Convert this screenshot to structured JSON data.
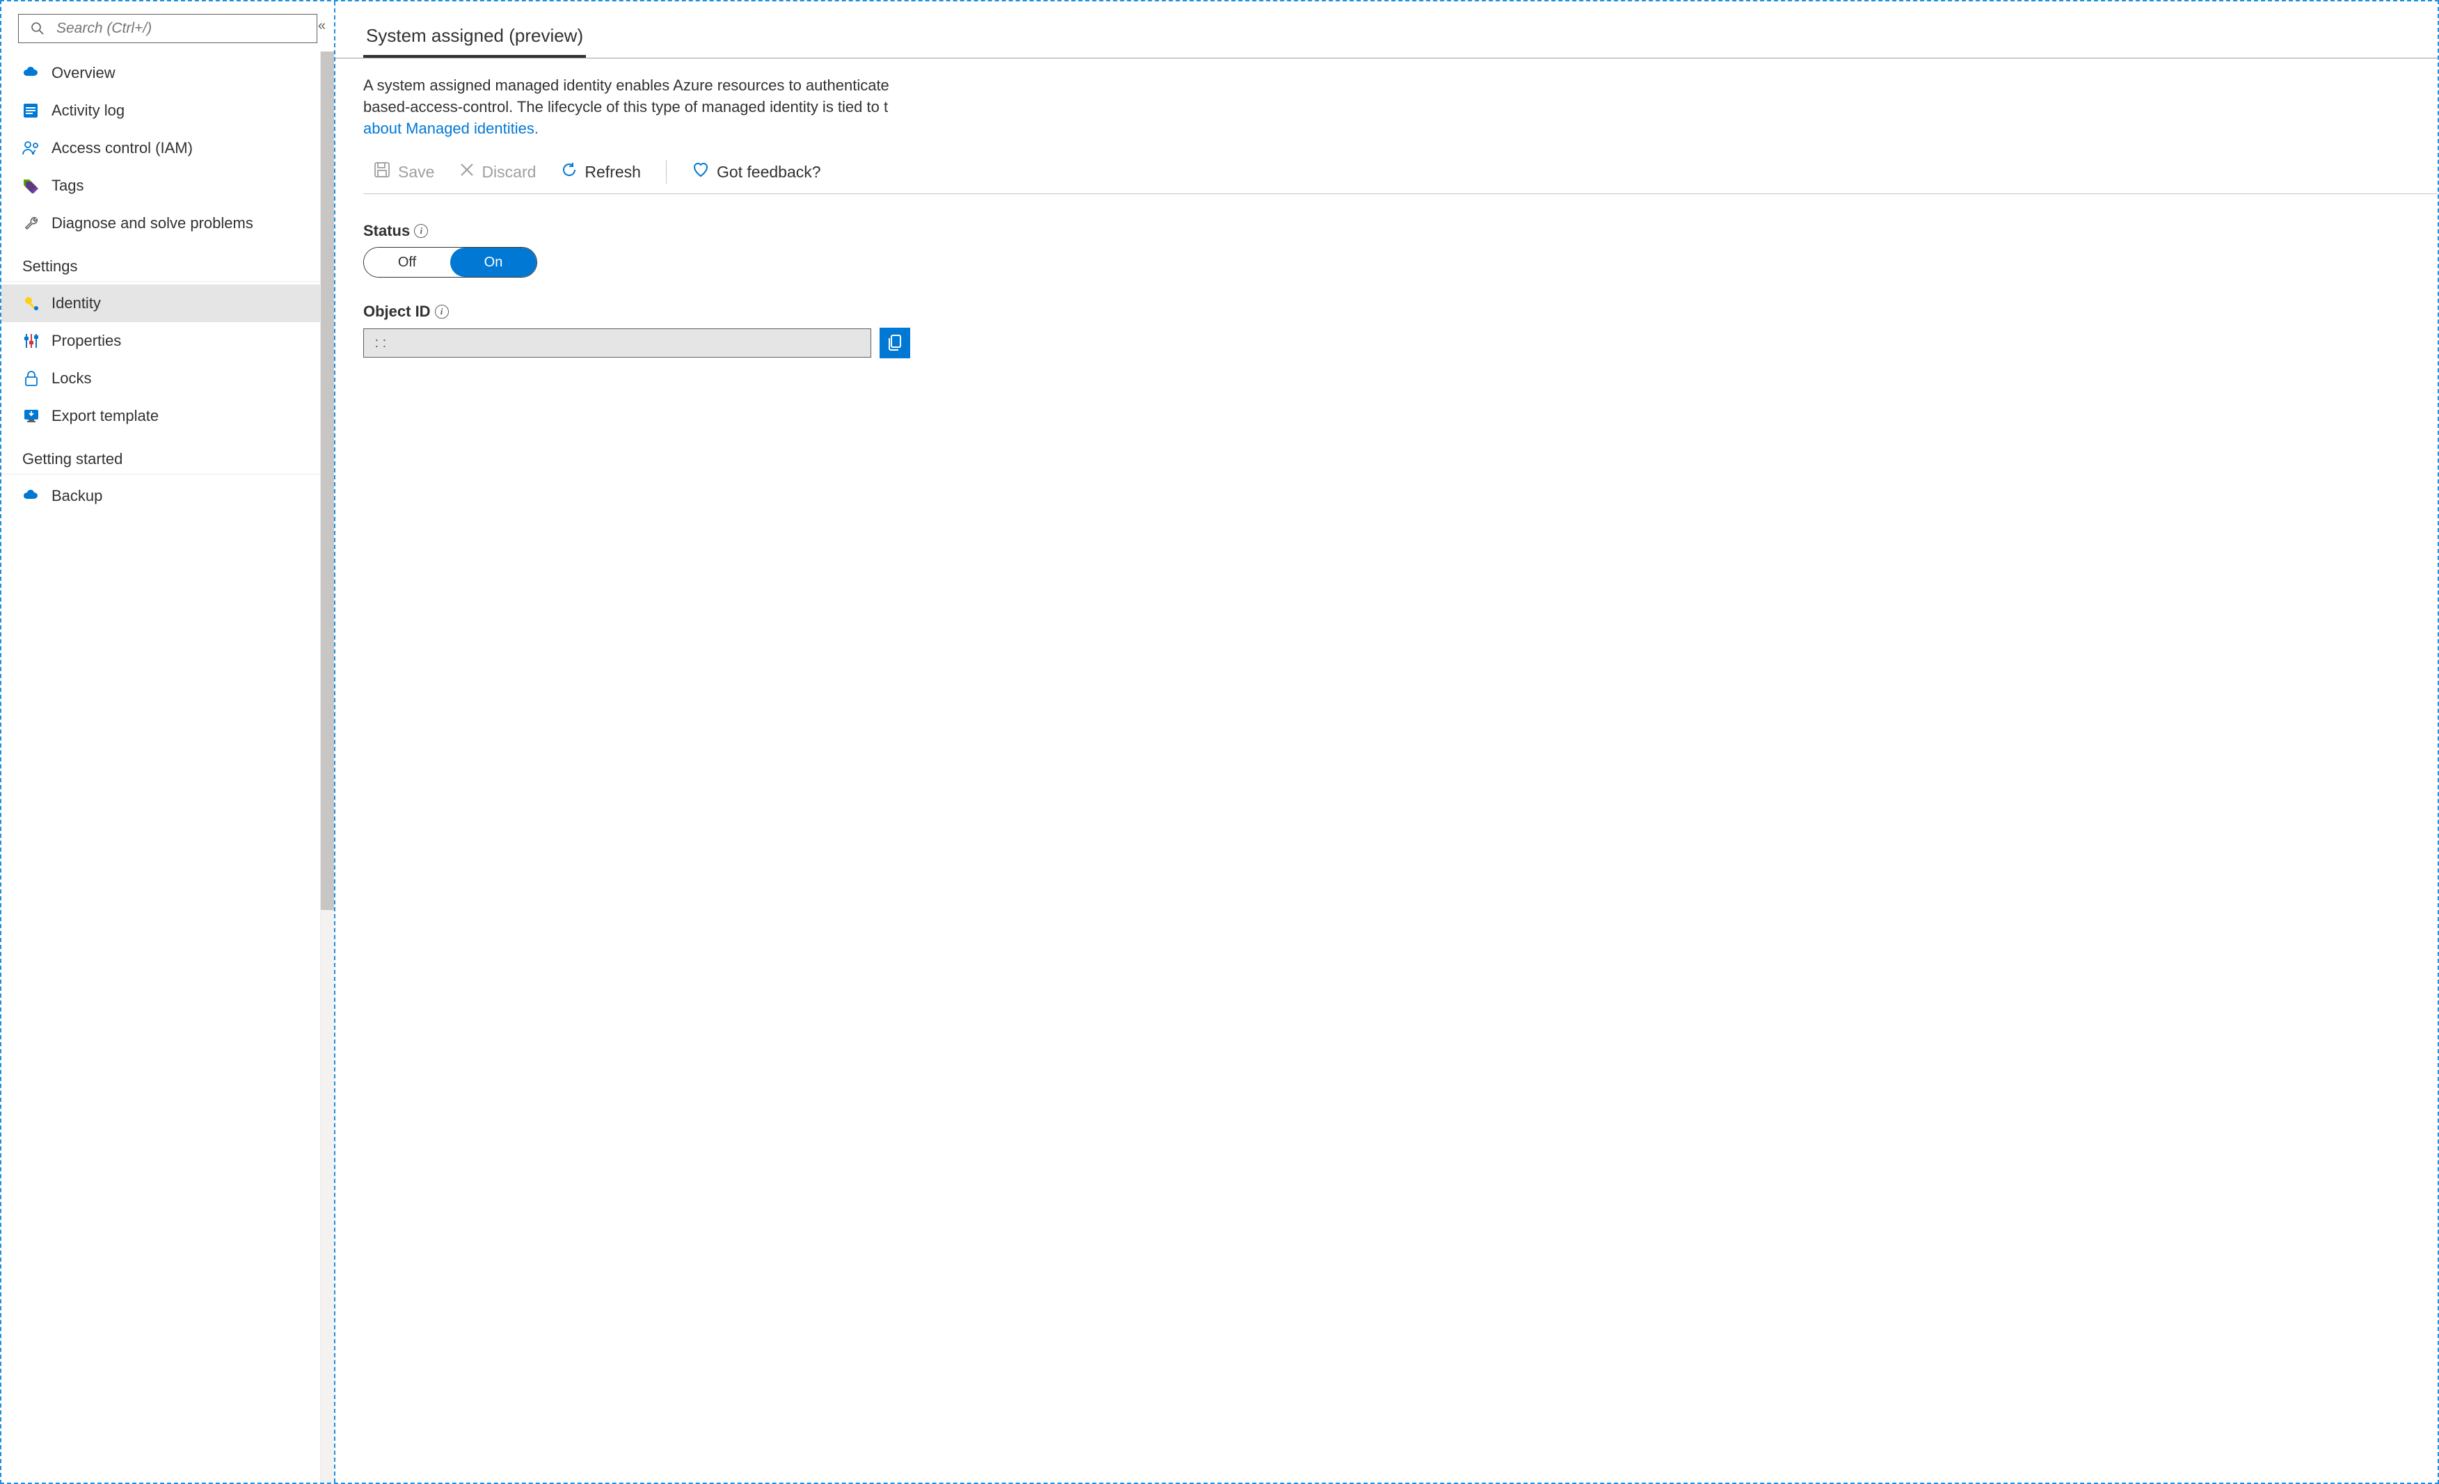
{
  "colors": {
    "azure_blue": "#0078d4",
    "azure_red": "#d13438",
    "azure_green": "#57a300",
    "disabled_text": "#a19f9d"
  },
  "search": {
    "placeholder": "Search (Ctrl+/)"
  },
  "sidebar": {
    "items": [
      {
        "icon": "cloud-icon",
        "label": "Overview",
        "selected": false
      },
      {
        "icon": "log-icon",
        "label": "Activity log",
        "selected": false
      },
      {
        "icon": "people-icon",
        "label": "Access control (IAM)",
        "selected": false
      },
      {
        "icon": "tag-icon",
        "label": "Tags",
        "selected": false
      },
      {
        "icon": "wrench-icon",
        "label": "Diagnose and solve problems",
        "selected": false
      }
    ],
    "section_settings": "Settings",
    "settings_items": [
      {
        "icon": "key-icon",
        "label": "Identity",
        "selected": true
      },
      {
        "icon": "sliders-icon",
        "label": "Properties",
        "selected": false
      },
      {
        "icon": "lock-icon",
        "label": "Locks",
        "selected": false
      },
      {
        "icon": "export-icon",
        "label": "Export template",
        "selected": false
      }
    ],
    "section_getting_started": "Getting started",
    "getting_started_items": [
      {
        "icon": "cloud-icon",
        "label": "Backup",
        "selected": false
      }
    ]
  },
  "main": {
    "tab_label": "System assigned (preview)",
    "intro_text_1": "A system assigned managed identity enables Azure resources to authenticate ",
    "intro_text_2": "based-access-control. The lifecycle of this type of managed identity is tied to t",
    "intro_link": "about Managed identities.",
    "toolbar": {
      "save": "Save",
      "discard": "Discard",
      "refresh": "Refresh",
      "feedback": "Got feedback?"
    },
    "status": {
      "label": "Status",
      "off": "Off",
      "on": "On",
      "value": "On"
    },
    "object_id": {
      "label": "Object ID",
      "value": " : : "
    }
  }
}
